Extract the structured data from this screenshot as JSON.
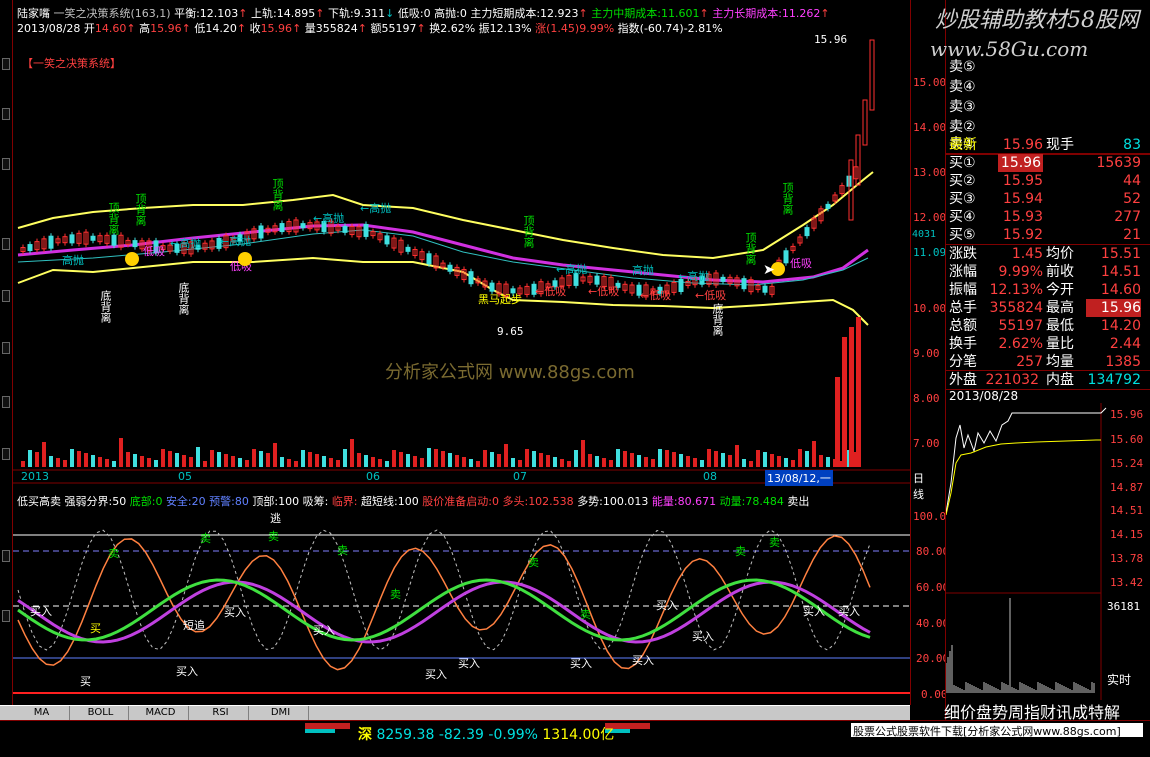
{
  "header": {
    "stock_name": "陆家嘴",
    "indicator_name": "一笑之决策系统(163,1)",
    "balance_label": "平衡:",
    "balance": "12.103",
    "upper_label": "上轨:",
    "upper": "14.895",
    "lower_label": "下轨:",
    "lower": "9.311",
    "low_absorb_label": "低吸:",
    "low_absorb": "0",
    "high_sell_label": "高抛:",
    "high_sell": "0",
    "short_cost_label": "主力短期成本:",
    "short_cost": "12.923",
    "mid_cost_label": "主力中期成本:",
    "mid_cost": "11.601",
    "long_cost_label": "主力长期成本:",
    "long_cost": "11.262"
  },
  "ohlc": {
    "date": "2013/08/28",
    "open_label": "开",
    "open": "14.60",
    "high_label": "高",
    "high": "15.96",
    "low_label": "低",
    "low": "14.20",
    "close_label": "收",
    "close": "15.96",
    "volume_label": "量",
    "volume": "355824",
    "amount_label": "额",
    "amount": "55197",
    "turnover_label": "换",
    "turnover": "2.62%",
    "amplitude_label": "振",
    "amplitude": "12.13%",
    "change_label": "涨",
    "change": "(1.45)9.99%",
    "index_label": "指数",
    "index": "(-60.74)-2.81%"
  },
  "chart_labels": {
    "system_tag": "【一笑之决策系统】",
    "top_price": "15.96",
    "low_price": "9.65",
    "dark_horse": "黑马起步",
    "watermark": "分析家公式网 www.88gs.com",
    "high_sell": "高抛",
    "low_buy": "低吸",
    "top_divergence": "顶背离",
    "bottom_divergence": "底背离",
    "arrow_high": "←高抛",
    "arrow_low": "←低吸"
  },
  "price_axis": [
    "15.00",
    "14.00",
    "13.00",
    "12.00",
    "11.00",
    "10.00",
    "9.00",
    "8.00",
    "7.00"
  ],
  "price_axis_marker": "4031",
  "price_axis_marker2": "11.09",
  "time_axis": {
    "labels": [
      "2013",
      "05",
      "06",
      "07",
      "08"
    ],
    "cursor_date": "13/08/12,一",
    "period": "日线"
  },
  "sub_indicator": {
    "name": "低买高卖",
    "strength_label": "强弱分界:",
    "strength": "50",
    "bottom_label": "底部:",
    "bottom": "0",
    "safe_label": "安全:",
    "safe": "20",
    "warn_label": "预警:",
    "warn": "80",
    "top_label": "顶部:",
    "top": "100",
    "absorb_label": "吸筹:",
    "absorb": "",
    "critical_label": "临界:",
    "critical": "",
    "super_short_label": "超短线:",
    "super_short": "100",
    "prepare_label": "股价准备启动:",
    "prepare": "0",
    "long_label": "多头:",
    "long": "102.538",
    "trend_label": "多势:",
    "trend": "100.013",
    "energy_label": "能量:",
    "energy": "80.671",
    "momentum_label": "动量:",
    "momentum": "78.484",
    "sell_label": "卖出"
  },
  "sub_axis": [
    "100.00",
    "80.00",
    "60.00",
    "40.00",
    "20.00",
    "0.00"
  ],
  "sub_labels": {
    "buy": "买入",
    "sell": "卖",
    "buy_short": "买",
    "short_chase": "短追",
    "escape": "逃"
  },
  "tabs": [
    "MA",
    "BOLL",
    "MACD",
    "RSI",
    "DMI"
  ],
  "status_bar": {
    "market": "深",
    "index_value": "8259.38",
    "index_change": "-82.39",
    "index_pct": "-0.99%",
    "turnover": "1314.00亿",
    "link_text": "股票公式股票软件下载[分析家公式网www.88gs.com]",
    "ticker_text": "细价盘势周指财讯成特解"
  },
  "quote_panel": {
    "watermark_line1": "炒股辅助教材58股网",
    "watermark_line2": "www.58Gu.com",
    "sell_levels": [
      "卖⑤",
      "卖④",
      "卖③",
      "卖②",
      "卖①"
    ],
    "latest_label": "最新",
    "latest": "15.96",
    "current_hand_label": "现手",
    "current_hand": "83",
    "buy_levels": [
      {
        "label": "买①",
        "price": "15.96",
        "vol": "15639"
      },
      {
        "label": "买②",
        "price": "15.95",
        "vol": "44"
      },
      {
        "label": "买③",
        "price": "15.94",
        "vol": "52"
      },
      {
        "label": "买④",
        "price": "15.93",
        "vol": "277"
      },
      {
        "label": "买⑤",
        "price": "15.92",
        "vol": "21"
      }
    ],
    "stats": [
      {
        "l1": "涨跌",
        "v1": "1.45",
        "l2": "均价",
        "v2": "15.51"
      },
      {
        "l1": "涨幅",
        "v1": "9.99%",
        "l2": "前收",
        "v2": "14.51"
      },
      {
        "l1": "振幅",
        "v1": "12.13%",
        "l2": "今开",
        "v2": "14.60"
      },
      {
        "l1": "总手",
        "v1": "355824",
        "l2": "最高",
        "v2": "15.96"
      },
      {
        "l1": "总额",
        "v1": "55197",
        "l2": "最低",
        "v2": "14.20"
      },
      {
        "l1": "换手",
        "v1": "2.62%",
        "l2": "量比",
        "v2": "2.44"
      },
      {
        "l1": "分笔",
        "v1": "257",
        "l2": "均量",
        "v2": "1385"
      }
    ],
    "outer_label": "外盘",
    "outer": "221032",
    "inner_label": "内盘",
    "inner": "134792",
    "mini_date": "2013/08/28",
    "mini_axis": [
      "15.96",
      "15.60",
      "15.24",
      "14.87",
      "14.51",
      "14.15",
      "13.78",
      "13.42"
    ],
    "mini_vol": "36181",
    "realtime_label": "实时"
  }
}
